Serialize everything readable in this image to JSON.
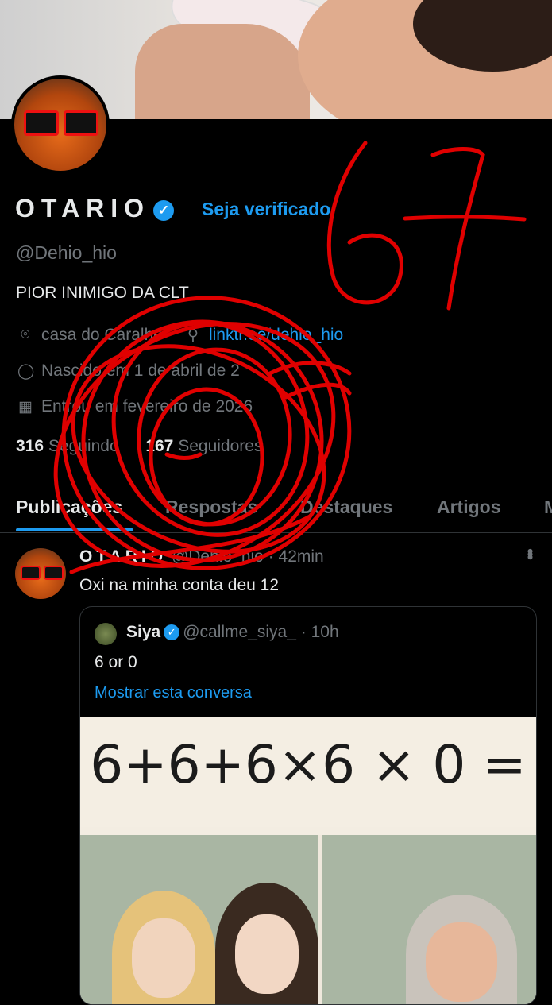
{
  "profile": {
    "display_name": "OTARIO",
    "verify_cta": "Seja verificado",
    "handle": "@Dehio_hio",
    "bio": "PIOR INIMIGO DA CLT",
    "location": "casa do Caralho",
    "website": "linktr.ee/dehio_hio",
    "birth": "Nascido em 1 de abril de 2",
    "joined": "Entrou em fevereiro de 2026",
    "following_count": "316",
    "following_label": "Seguindo",
    "followers_count": "167",
    "followers_label": "Seguidores"
  },
  "tabs": [
    "Publicações",
    "Respostas",
    "Destaques",
    "Artigos",
    "M"
  ],
  "post": {
    "author": "OTARIO",
    "handle": "@Dehio_hio",
    "time": "· 42min",
    "text": "Oxi na minha conta deu 12",
    "quote": {
      "author": "Siya",
      "handle": "@callme_siya_",
      "time": "· 10h",
      "text": "6 or 0",
      "show_thread": "Mostrar esta conversa",
      "image_text": "6+6+6×6 × 0 ="
    }
  },
  "annotation": {
    "handwritten": "67"
  },
  "colors": {
    "background": "#000000",
    "accent": "#1d9bf0",
    "muted": "#71767b",
    "scribble": "#e00000"
  }
}
